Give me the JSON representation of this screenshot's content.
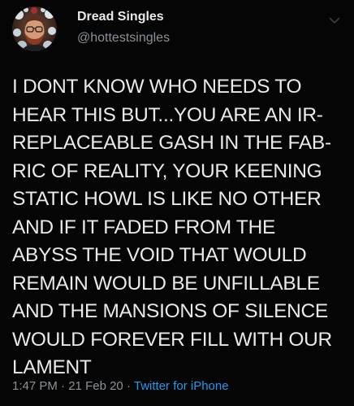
{
  "tweet": {
    "author": {
      "display_name": "Dread Singles",
      "handle": "@hottestsingles",
      "avatar_icon": "avatar-photo"
    },
    "text": "I DONT KNOW WHO NEEDS TO\nHEAR THIS BUT...YOU ARE AN IR-\nREPLACEABLE GASH IN THE FAB-\nRIC OF REALITY, YOUR KEENING\nSTATIC HOWL IS LIKE NO OTHER\nAND IF IT FADED FROM THE\nABYSS THE VOID THAT WOULD\nREMAIN WOULD BE UNFILLABLE\nAND THE MANSIONS OF SILENCE\nWOULD FOREVER FILL WITH OUR\nLAMENT",
    "time": "1:47 PM",
    "date": "21 Feb 20",
    "source": "Twitter for iPhone",
    "separator": "·",
    "menu_icon": "chevron-down-icon"
  },
  "colors": {
    "background": "#050505",
    "text": "#e7e9ea",
    "muted": "#8b9298",
    "link": "#1d9bf0"
  }
}
